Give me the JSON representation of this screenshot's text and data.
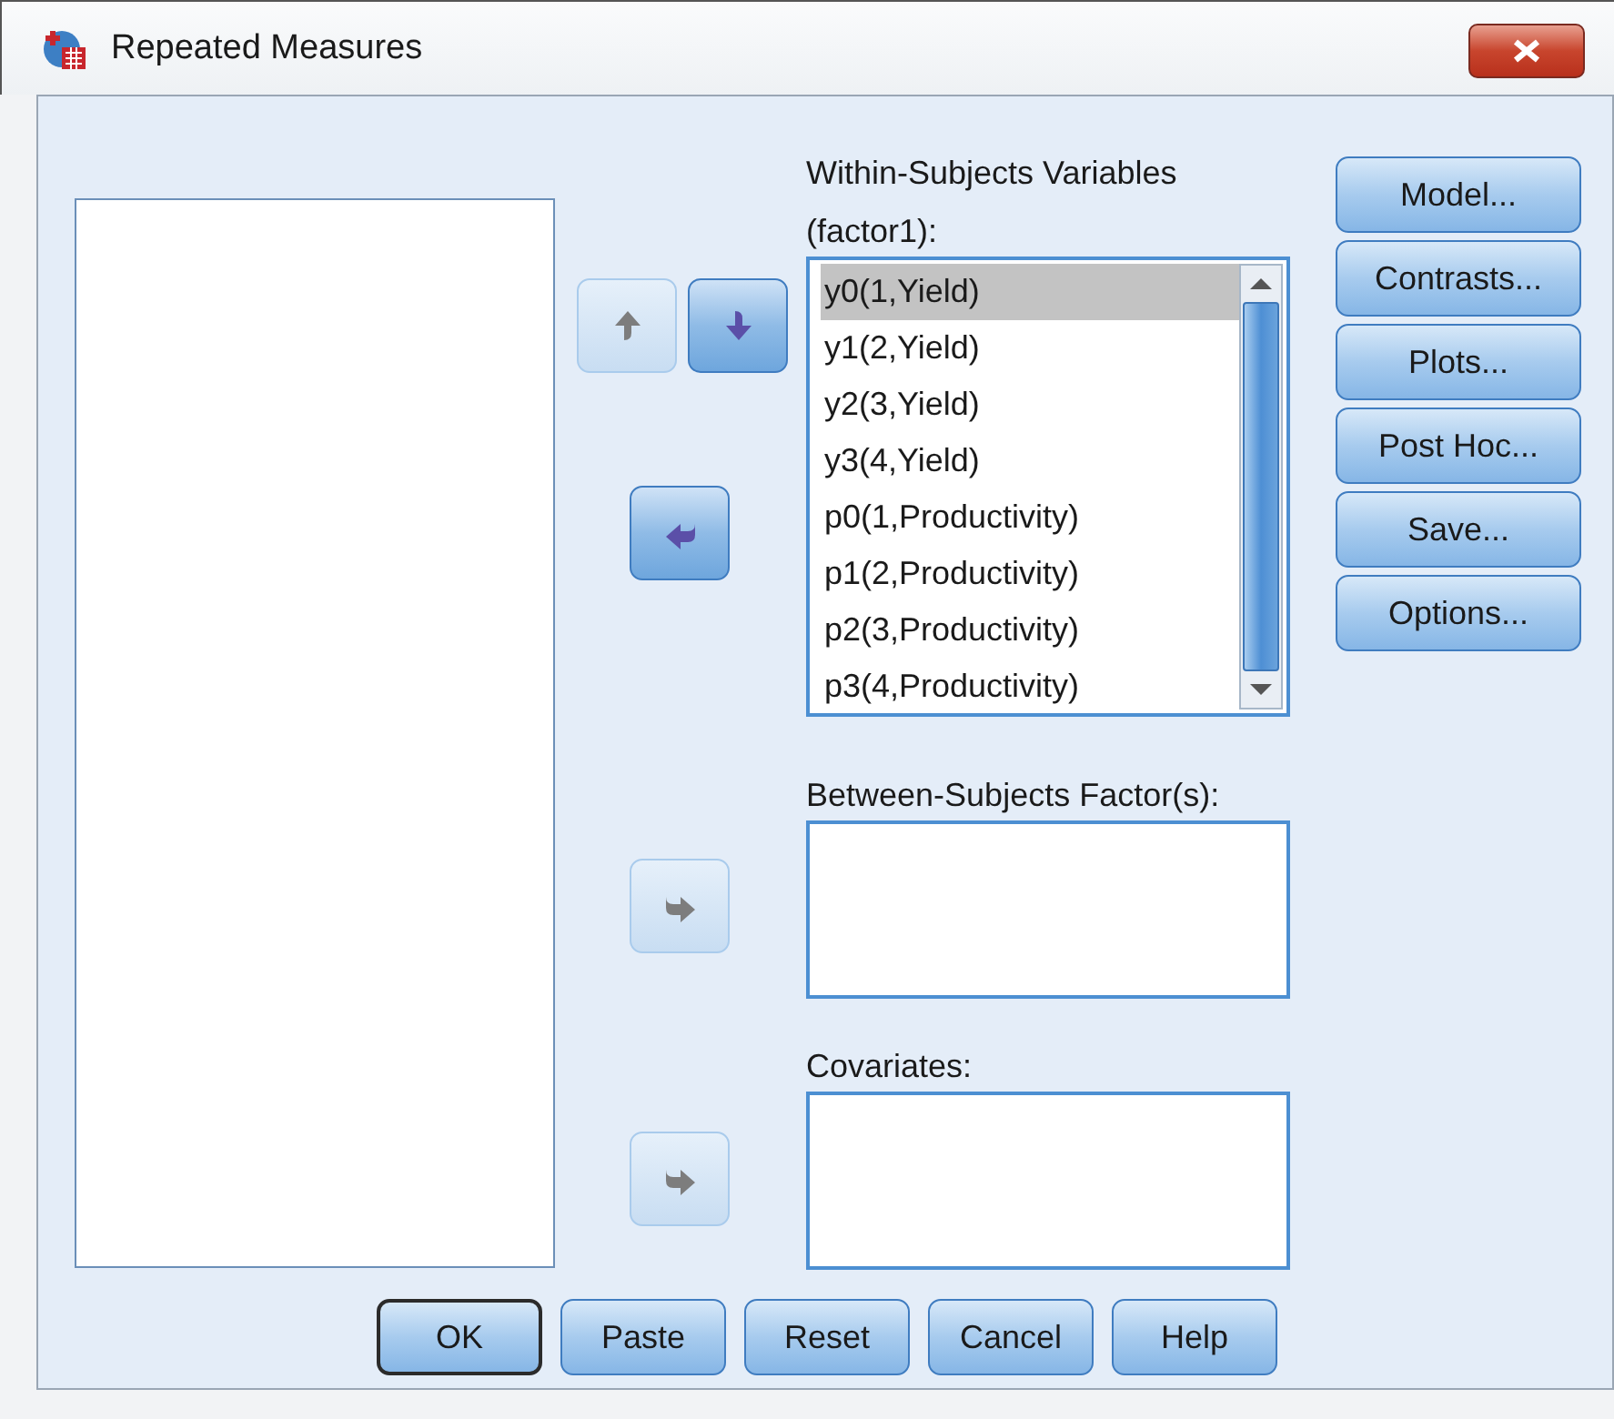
{
  "window": {
    "title": "Repeated Measures"
  },
  "within": {
    "label": "Within-Subjects Variables",
    "sublabel": "(factor1):",
    "items": [
      {
        "text": "y0(1,Yield)",
        "selected": true
      },
      {
        "text": "y1(2,Yield)",
        "selected": false
      },
      {
        "text": "y2(3,Yield)",
        "selected": false
      },
      {
        "text": "y3(4,Yield)",
        "selected": false
      },
      {
        "text": "p0(1,Productivity)",
        "selected": false
      },
      {
        "text": "p1(2,Productivity)",
        "selected": false
      },
      {
        "text": "p2(3,Productivity)",
        "selected": false
      },
      {
        "text": "p3(4,Productivity)",
        "selected": false
      }
    ]
  },
  "arrows": {
    "move_up": {
      "disabled": true
    },
    "move_down": {
      "disabled": false
    },
    "move_within": {
      "disabled": false
    },
    "move_between": {
      "disabled": true
    },
    "move_covariates": {
      "disabled": true
    }
  },
  "between": {
    "label": "Between-Subjects Factor(s):"
  },
  "covariates": {
    "label": "Covariates:"
  },
  "side_buttons": [
    {
      "label": "Model..."
    },
    {
      "label": "Contrasts..."
    },
    {
      "label": "Plots..."
    },
    {
      "label": "Post Hoc..."
    },
    {
      "label": "Save..."
    },
    {
      "label": "Options..."
    }
  ],
  "bottom_buttons": [
    {
      "label": "OK",
      "default": true
    },
    {
      "label": "Paste",
      "default": false
    },
    {
      "label": "Reset",
      "default": false
    },
    {
      "label": "Cancel",
      "default": false
    },
    {
      "label": "Help",
      "default": false
    }
  ]
}
